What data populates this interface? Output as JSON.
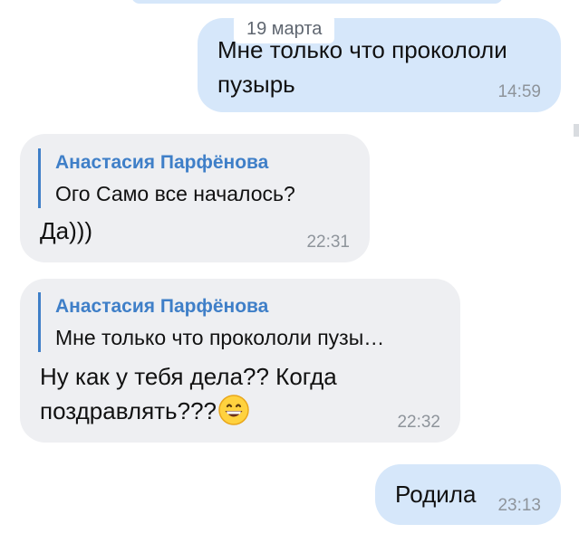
{
  "date_chip": "19 марта",
  "messages": [
    {
      "direction": "outgoing",
      "lines": [
        "Мне только что прокололи",
        "пузырь"
      ],
      "time": "14:59"
    },
    {
      "direction": "incoming",
      "reply_author": "Анастасия Парфёнова",
      "reply_text": "Ого Само все началось?",
      "text": "Да)))",
      "time": "22:31"
    },
    {
      "direction": "incoming",
      "reply_author": "Анастасия Парфёнова",
      "reply_text": "Мне только что прокололи пузы…",
      "lines": [
        "Ну как у тебя дела?? Когда",
        "поздравлять???"
      ],
      "emoji": "grinning-face-icon",
      "time": "22:32"
    },
    {
      "direction": "outgoing",
      "text": "Родила",
      "time": "23:13"
    }
  ],
  "colors": {
    "outgoing_bubble": "#d6e7fa",
    "incoming_bubble": "#eeeff2",
    "reply_accent": "#3f7fc8",
    "time_text": "#8e949b",
    "message_text": "#111111"
  }
}
